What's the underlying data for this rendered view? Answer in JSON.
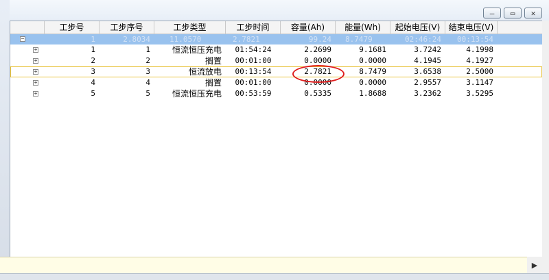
{
  "window": {
    "minimize_glyph": "‒",
    "maximize_glyph": "▭",
    "close_glyph": "✕"
  },
  "columns": [
    "工步号",
    "工步序号",
    "工步类型",
    "工步时间",
    "容量(Ah)",
    "能量(Wh)",
    "起始电压(V)",
    "结束电压(V)"
  ],
  "group_row": {
    "expander": "−",
    "values": [
      "1",
      "2.8034",
      "11.0570",
      "2.7821",
      "99.24",
      "8.7479",
      "02:46:24",
      "00:13:54"
    ]
  },
  "rows": [
    {
      "expander": "+",
      "step": "1",
      "seq": "1",
      "type": "恒流恒压充电",
      "time": "01:54:24",
      "capacity": "2.2699",
      "energy": "9.1681",
      "start_v": "3.7242",
      "end_v": "4.1998"
    },
    {
      "expander": "+",
      "step": "2",
      "seq": "2",
      "type": "搁置",
      "time": "00:01:00",
      "capacity": "0.0000",
      "energy": "0.0000",
      "start_v": "4.1945",
      "end_v": "4.1927"
    },
    {
      "expander": "+",
      "step": "3",
      "seq": "3",
      "type": "恒流放电",
      "time": "00:13:54",
      "capacity": "2.7821",
      "energy": "8.7479",
      "start_v": "3.6538",
      "end_v": "2.5000"
    },
    {
      "expander": "+",
      "step": "4",
      "seq": "4",
      "type": "搁置",
      "time": "00:01:00",
      "capacity": "0.0000",
      "energy": "0.0000",
      "start_v": "2.9557",
      "end_v": "3.1147"
    },
    {
      "expander": "+",
      "step": "5",
      "seq": "5",
      "type": "恒流恒压充电",
      "time": "00:53:59",
      "capacity": "0.5335",
      "energy": "1.8688",
      "start_v": "3.2362",
      "end_v": "3.5295"
    }
  ],
  "scroll_right_glyph": "▶",
  "colors": {
    "group_row_bg": "#99c2ee",
    "selected_outline": "#e8c23a",
    "annotation_circle": "#e02020",
    "status_bg": "#fffde6"
  }
}
